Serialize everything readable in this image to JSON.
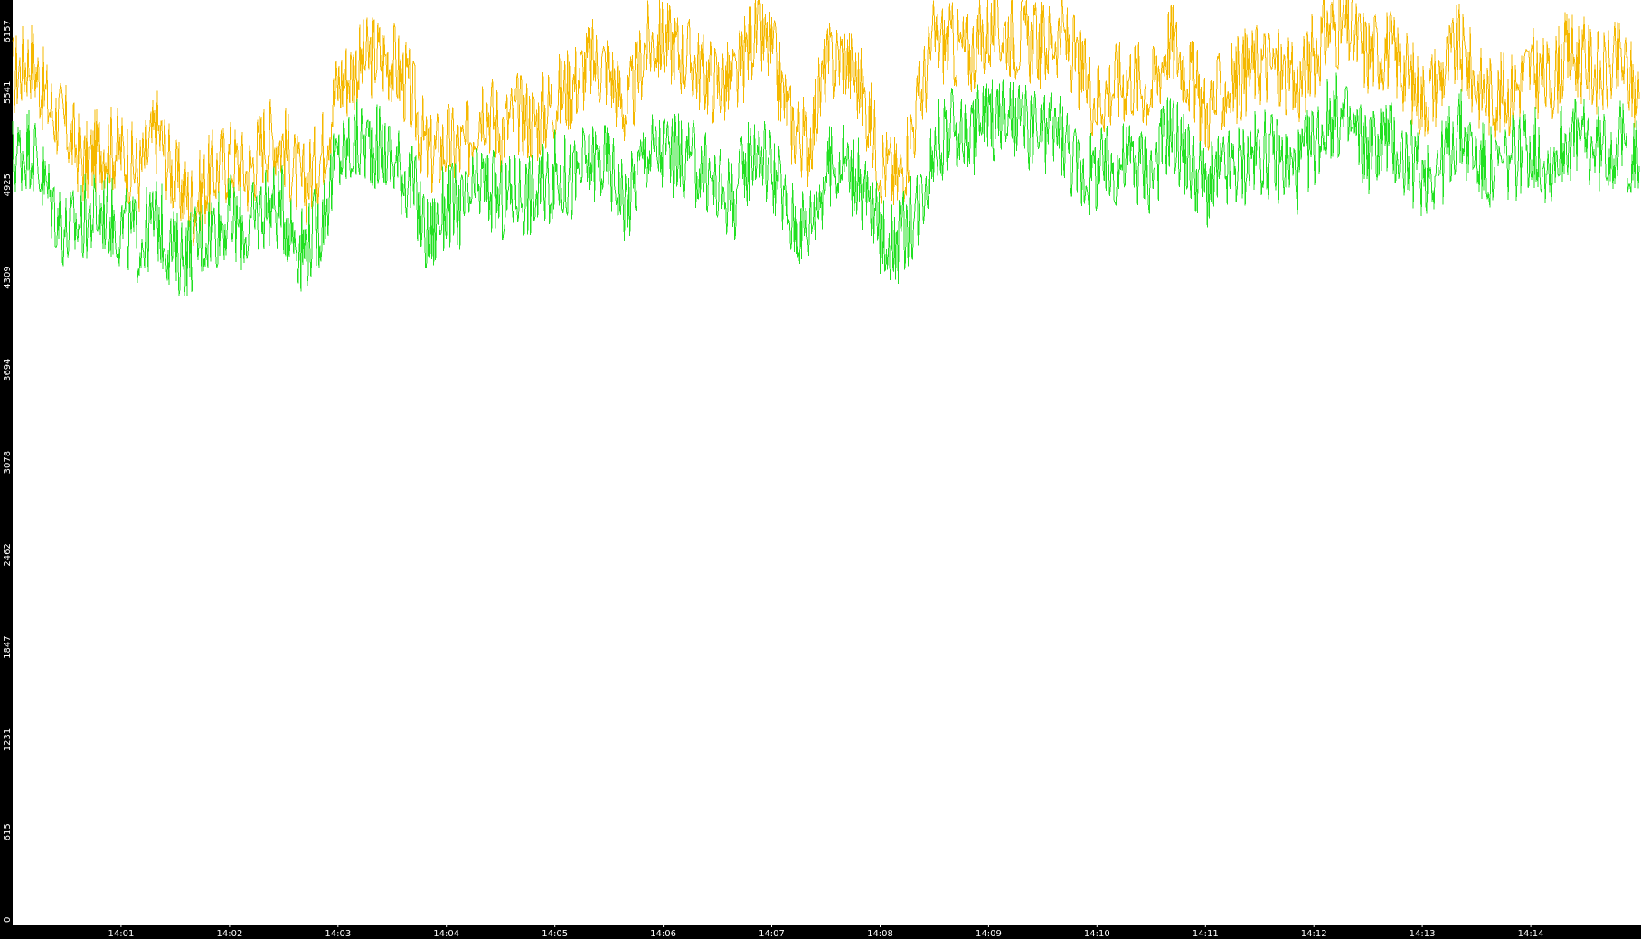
{
  "chart_data": {
    "type": "line",
    "title": "",
    "xlabel": "",
    "ylabel": "",
    "grid": false,
    "legend": "none",
    "ylim": [
      0,
      6157
    ],
    "xlim": [
      "14:00:00",
      "14:15:00"
    ],
    "y_ticks": [
      "0",
      "615",
      "1231",
      "1847",
      "2462",
      "3078",
      "3694",
      "4309",
      "4925",
      "5541",
      "6157"
    ],
    "x_ticks": [
      {
        "t": "14:01:00",
        "label": "14:01"
      },
      {
        "t": "14:02:00",
        "label": "14:02"
      },
      {
        "t": "14:03:00",
        "label": "14:03"
      },
      {
        "t": "14:04:00",
        "label": "14:04"
      },
      {
        "t": "14:05:00",
        "label": "14:05"
      },
      {
        "t": "14:06:00",
        "label": "14:06"
      },
      {
        "t": "14:07:00",
        "label": "14:07"
      },
      {
        "t": "14:08:00",
        "label": "14:08"
      },
      {
        "t": "14:09:00",
        "label": "14:09"
      },
      {
        "t": "14:10:00",
        "label": "14:10"
      },
      {
        "t": "14:11:00",
        "label": "14:11"
      },
      {
        "t": "14:12:00",
        "label": "14:12"
      },
      {
        "t": "14:13:00",
        "label": "14:13"
      },
      {
        "t": "14:14:00",
        "label": "14:14"
      }
    ],
    "series": [
      {
        "color": "#f5b800",
        "x": [
          "14:00:00",
          "14:00:10",
          "14:00:20",
          "14:00:30",
          "14:00:40",
          "14:00:50",
          "14:01:00",
          "14:01:10",
          "14:01:20",
          "14:01:30",
          "14:01:40",
          "14:01:50",
          "14:02:00",
          "14:02:10",
          "14:02:20",
          "14:02:30",
          "14:02:40",
          "14:02:50",
          "14:03:00",
          "14:03:10",
          "14:03:20",
          "14:03:30",
          "14:03:40",
          "14:03:50",
          "14:04:00",
          "14:04:10",
          "14:04:20",
          "14:04:30",
          "14:04:40",
          "14:04:50",
          "14:05:00",
          "14:05:10",
          "14:05:20",
          "14:05:30",
          "14:05:40",
          "14:05:50",
          "14:06:00",
          "14:06:10",
          "14:06:20",
          "14:06:30",
          "14:06:40",
          "14:06:50",
          "14:07:00",
          "14:07:10",
          "14:07:20",
          "14:07:30",
          "14:07:40",
          "14:07:50",
          "14:08:00",
          "14:08:10",
          "14:08:20",
          "14:08:30",
          "14:08:40",
          "14:08:50",
          "14:09:00",
          "14:09:10",
          "14:09:20",
          "14:09:30",
          "14:09:40",
          "14:09:50",
          "14:10:00",
          "14:10:10",
          "14:10:20",
          "14:10:30",
          "14:10:40",
          "14:10:50",
          "14:11:00",
          "14:11:10",
          "14:11:20",
          "14:11:30",
          "14:11:40",
          "14:11:50",
          "14:12:00",
          "14:12:10",
          "14:12:20",
          "14:12:30",
          "14:12:40",
          "14:12:50",
          "14:13:00",
          "14:13:10",
          "14:13:20",
          "14:13:30",
          "14:13:40",
          "14:13:50",
          "14:14:00",
          "14:14:10",
          "14:14:20",
          "14:14:30",
          "14:14:40",
          "14:14:50",
          "14:15:00"
        ],
        "y": [
          5650,
          5780,
          5450,
          5300,
          5050,
          5200,
          5150,
          5000,
          5300,
          4950,
          4800,
          5000,
          5100,
          5000,
          5250,
          5200,
          4900,
          5100,
          5600,
          5700,
          5800,
          5750,
          5550,
          5100,
          5200,
          5150,
          5500,
          5300,
          5400,
          5350,
          5500,
          5600,
          5750,
          5700,
          5400,
          5850,
          5900,
          5800,
          5700,
          5600,
          5600,
          5950,
          5800,
          5350,
          5200,
          5700,
          5800,
          5550,
          5100,
          4950,
          5400,
          5900,
          5850,
          5800,
          5950,
          5950,
          5900,
          5850,
          5950,
          5700,
          5500,
          5600,
          5650,
          5550,
          5900,
          5700,
          5400,
          5550,
          5650,
          5750,
          5700,
          5550,
          5800,
          6000,
          5950,
          5800,
          5850,
          5700,
          5500,
          5650,
          5850,
          5600,
          5500,
          5550,
          5700,
          5600,
          5800,
          5750,
          5650,
          5750,
          5500
        ]
      },
      {
        "color": "#22e022",
        "x": [
          "14:00:00",
          "14:00:10",
          "14:00:20",
          "14:00:30",
          "14:00:40",
          "14:00:50",
          "14:01:00",
          "14:01:10",
          "14:01:20",
          "14:01:30",
          "14:01:40",
          "14:01:50",
          "14:02:00",
          "14:02:10",
          "14:02:20",
          "14:02:30",
          "14:02:40",
          "14:02:50",
          "14:03:00",
          "14:03:10",
          "14:03:20",
          "14:03:30",
          "14:03:40",
          "14:03:50",
          "14:04:00",
          "14:04:10",
          "14:04:20",
          "14:04:30",
          "14:04:40",
          "14:04:50",
          "14:05:00",
          "14:05:10",
          "14:05:20",
          "14:05:30",
          "14:05:40",
          "14:05:50",
          "14:06:00",
          "14:06:10",
          "14:06:20",
          "14:06:30",
          "14:06:40",
          "14:06:50",
          "14:07:00",
          "14:07:10",
          "14:07:20",
          "14:07:30",
          "14:07:40",
          "14:07:50",
          "14:08:00",
          "14:08:10",
          "14:08:20",
          "14:08:30",
          "14:08:40",
          "14:08:50",
          "14:09:00",
          "14:09:10",
          "14:09:20",
          "14:09:30",
          "14:09:40",
          "14:09:50",
          "14:10:00",
          "14:10:10",
          "14:10:20",
          "14:10:30",
          "14:10:40",
          "14:10:50",
          "14:11:00",
          "14:11:10",
          "14:11:20",
          "14:11:30",
          "14:11:40",
          "14:11:50",
          "14:12:00",
          "14:12:10",
          "14:12:20",
          "14:12:30",
          "14:12:40",
          "14:12:50",
          "14:13:00",
          "14:13:10",
          "14:13:20",
          "14:13:30",
          "14:13:40",
          "14:13:50",
          "14:14:00",
          "14:14:10",
          "14:14:20",
          "14:14:30",
          "14:14:40",
          "14:14:50",
          "14:15:00"
        ],
        "y": [
          5100,
          5200,
          4850,
          4600,
          4700,
          4750,
          4650,
          4550,
          4700,
          4450,
          4500,
          4650,
          4700,
          4600,
          4800,
          4750,
          4500,
          4650,
          5100,
          5200,
          5200,
          5100,
          4950,
          4550,
          4800,
          4750,
          4950,
          4800,
          4900,
          4850,
          5000,
          4950,
          5100,
          5050,
          4800,
          5150,
          5150,
          5100,
          5050,
          4900,
          4850,
          5200,
          5050,
          4700,
          4650,
          5000,
          5100,
          4900,
          4600,
          4550,
          4750,
          5200,
          5300,
          5250,
          5400,
          5350,
          5300,
          5250,
          5300,
          5000,
          5000,
          5050,
          5100,
          5000,
          5300,
          5100,
          4900,
          5000,
          5050,
          5150,
          5100,
          5000,
          5200,
          5400,
          5300,
          5150,
          5250,
          5100,
          5000,
          5050,
          5300,
          5100,
          5000,
          5100,
          5200,
          5050,
          5250,
          5200,
          5150,
          5200,
          5050
        ]
      }
    ]
  }
}
